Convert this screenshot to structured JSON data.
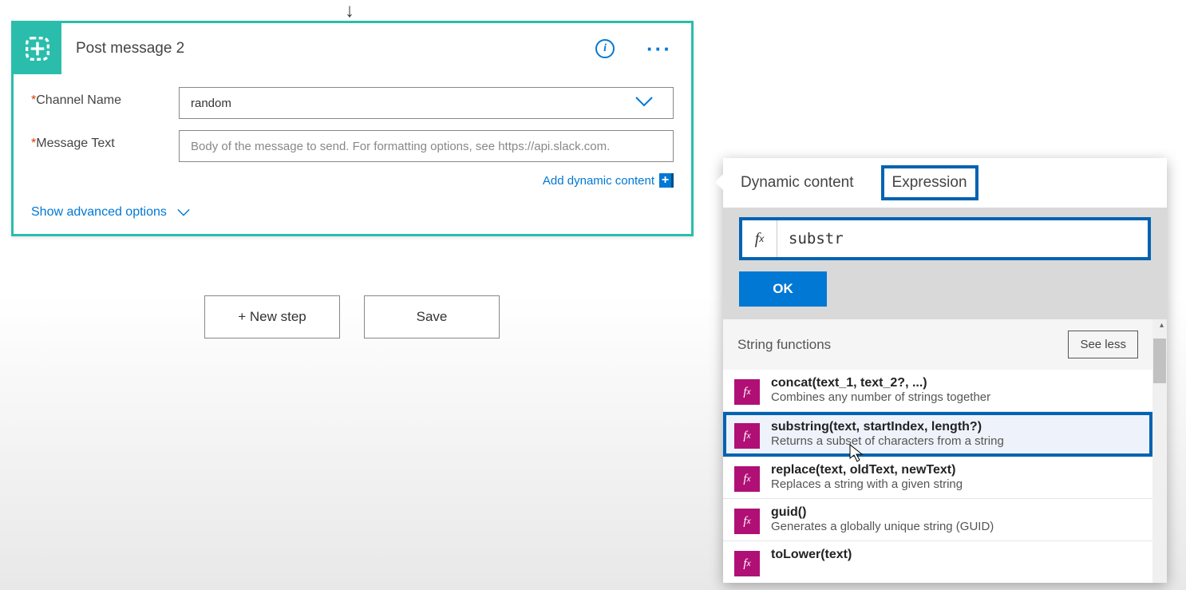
{
  "action": {
    "title": "Post message 2",
    "fields": {
      "channel": {
        "label": "Channel Name",
        "value": "random"
      },
      "message": {
        "label": "Message Text",
        "placeholder": "Body of the message to send. For formatting options, see https://api.slack.com."
      }
    },
    "addDynamicContent": "Add dynamic content",
    "showAdvanced": "Show advanced options"
  },
  "buttons": {
    "newStep": "+ New step",
    "save": "Save"
  },
  "popup": {
    "tabs": {
      "dynamic": "Dynamic content",
      "expression": "Expression"
    },
    "exprValue": "substr",
    "ok": "OK",
    "category": "String functions",
    "seeLess": "See less",
    "functions": [
      {
        "sig": "concat(text_1, text_2?, ...)",
        "desc": "Combines any number of strings together"
      },
      {
        "sig": "substring(text, startIndex, length?)",
        "desc": "Returns a subset of characters from a string"
      },
      {
        "sig": "replace(text, oldText, newText)",
        "desc": "Replaces a string with a given string"
      },
      {
        "sig": "guid()",
        "desc": "Generates a globally unique string (GUID)"
      },
      {
        "sig": "toLower(text)",
        "desc": ""
      }
    ]
  }
}
